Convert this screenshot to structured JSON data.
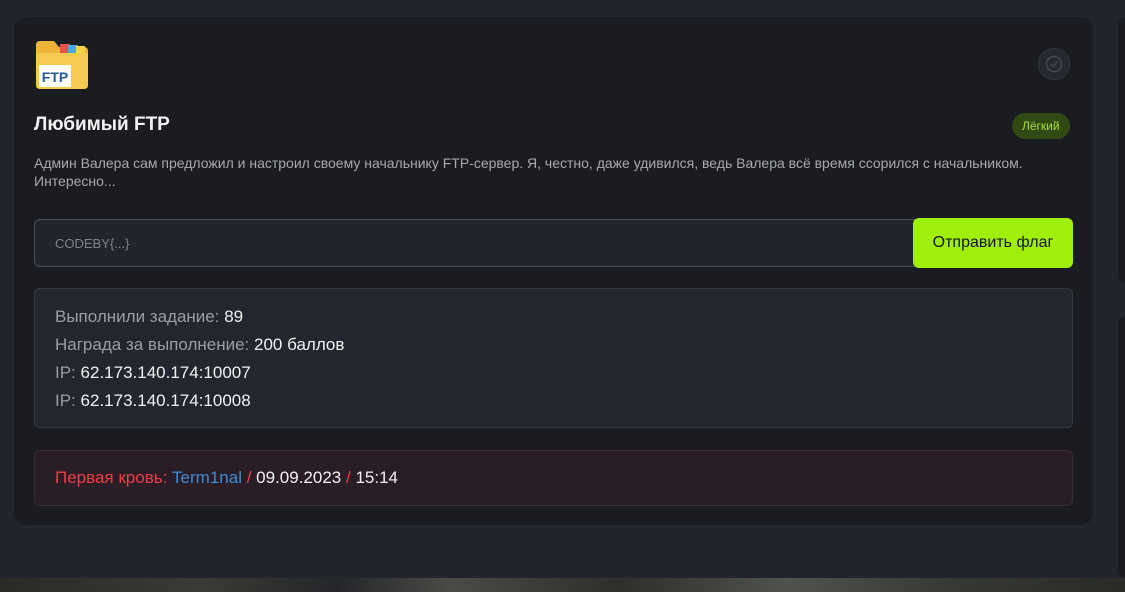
{
  "task": {
    "logo_text": "FTP",
    "title": "Любимый FTP",
    "difficulty": "Лёгкий",
    "description": "Админ Валера сам предложил и настроил своему начальнику FTP-сервер. Я, честно, даже удивился, ведь Валера всё время ссорился с начальником. Интересно..."
  },
  "flag_form": {
    "placeholder": "CODEBY{...}",
    "submit_label": "Отправить флаг"
  },
  "stats": {
    "solved_label": "Выполнили задание:",
    "solved_value": "89",
    "reward_label": "Награда за выполнение:",
    "reward_value": "200 баллов",
    "ip_label": "IP:",
    "ip1": "62.173.140.174:10007",
    "ip2": "62.173.140.174:10008"
  },
  "first_blood": {
    "label": "Первая кровь:",
    "user": "Term1nal",
    "separator": "/",
    "date": "09.09.2023",
    "time": "15:14"
  },
  "colors": {
    "accent": "#a0ee0c",
    "badge_text": "#a6e234",
    "first_blood": "#ee3d44",
    "user_link": "#3f8bd6"
  }
}
